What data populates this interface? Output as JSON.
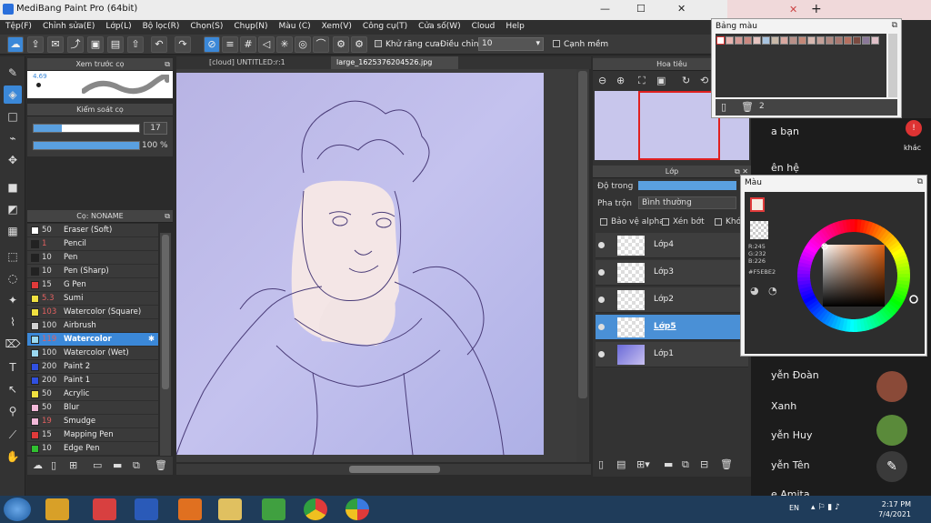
{
  "window": {
    "title": "MediBang Paint Pro (64bit)",
    "min": "—",
    "max": "☐",
    "close": "✕"
  },
  "menu": [
    "Tệp(F)",
    "Chỉnh sửa(E)",
    "Lớp(L)",
    "Bộ lọc(R)",
    "Chọn(S)",
    "Chụp(N)",
    "Màu (C)",
    "Xem(V)",
    "Công cụ(T)",
    "Cửa số(W)",
    "Cloud",
    "Help"
  ],
  "toolbar": {
    "antialias_label": "Khử răng cưa",
    "adjust_label": "Điều chỉnh",
    "adjust_value": "10",
    "smooth_label": "Cạnh mềm"
  },
  "brush_preview": {
    "title": "Xem trước cọ",
    "size": "4.69"
  },
  "brush_control": {
    "title": "Kiểm soát cọ",
    "size_value": "17",
    "opacity_value": "100 %",
    "size_fill": 0.27,
    "opacity_fill": 1.0
  },
  "brush_list": {
    "title": "Cọ: NONAME",
    "items": [
      {
        "size": "50",
        "name": "Eraser (Soft)",
        "color": "#ffffff",
        "red": false
      },
      {
        "size": "1",
        "name": "Pencil",
        "color": "#222222",
        "red": true
      },
      {
        "size": "10",
        "name": "Pen",
        "color": "#222222",
        "red": false
      },
      {
        "size": "10",
        "name": "Pen (Sharp)",
        "color": "#222222",
        "red": false
      },
      {
        "size": "15",
        "name": "G Pen",
        "color": "#e03a3a",
        "red": false
      },
      {
        "size": "5.3",
        "name": "Sumi",
        "color": "#f0e040",
        "red": true
      },
      {
        "size": "103",
        "name": "Watercolor (Square)",
        "color": "#f0e040",
        "red": true
      },
      {
        "size": "100",
        "name": "Airbrush",
        "color": "#d0d0d0",
        "red": false
      },
      {
        "size": "119",
        "name": "Watercolor",
        "color": "#9ad8f0",
        "red": true,
        "selected": true
      },
      {
        "size": "100",
        "name": "Watercolor (Wet)",
        "color": "#9ad8f0",
        "red": false
      },
      {
        "size": "200",
        "name": "Paint 2",
        "color": "#3050e0",
        "red": false
      },
      {
        "size": "200",
        "name": "Paint 1",
        "color": "#3050e0",
        "red": false
      },
      {
        "size": "50",
        "name": "Acrylic",
        "color": "#f0e040",
        "red": false
      },
      {
        "size": "50",
        "name": "Blur",
        "color": "#f2b8d8",
        "red": false
      },
      {
        "size": "19",
        "name": "Smudge",
        "color": "#f2b8d8",
        "red": true
      },
      {
        "size": "15",
        "name": "Mapping Pen",
        "color": "#e03a3a",
        "red": false
      },
      {
        "size": "10",
        "name": "Edge Pen",
        "color": "#30c030",
        "red": false
      }
    ]
  },
  "tabs": [
    "[cloud] UNTITLED:r:1",
    "large_1625376204526.jpg"
  ],
  "navigator": {
    "title": "Hoa tiêu"
  },
  "layers": {
    "title": "Lớp",
    "opacity_label": "Độ trong",
    "blend_label": "Pha trộn",
    "blend_value": "Bình thường",
    "protect_alpha": "Bảo vệ alpha",
    "clipping": "Xén bớt",
    "lock": "Khó",
    "items": [
      {
        "name": "Lớp4",
        "selected": false
      },
      {
        "name": "Lớp3",
        "selected": false
      },
      {
        "name": "Lớp2",
        "selected": false
      },
      {
        "name": "Lớp5",
        "selected": true
      },
      {
        "name": "Lớp1",
        "selected": false
      }
    ]
  },
  "palette": {
    "title": "Bảng màu",
    "count": "2",
    "swatches": [
      "#ffffff",
      "#e8b4b0",
      "#d49a96",
      "#c98880",
      "#e6c4c0",
      "#a8c4e0",
      "#c8b8a8",
      "#d8a8a0",
      "#b89088",
      "#c48878",
      "#d8b8b0",
      "#c4a098",
      "#b08880",
      "#a87870",
      "#b47060",
      "#7a4a40",
      "#8a7898",
      "#e0c0c8"
    ]
  },
  "color": {
    "title": "Màu",
    "r": "R:245",
    "g": "G:232",
    "b": "B:226",
    "hex": "#F5EBE2",
    "primary": "#f5ebe2",
    "accent": "#e03a3a"
  },
  "chat": {
    "items": [
      "a bạn",
      "ên hệ",
      "yễn Đoàn",
      "Xanh",
      "yễn Huy",
      "yễn Tên",
      "e Amita"
    ],
    "extra": "khác"
  },
  "taskbar": {
    "lang": "EN",
    "time": "2:17 PM",
    "date": "7/4/2021"
  }
}
